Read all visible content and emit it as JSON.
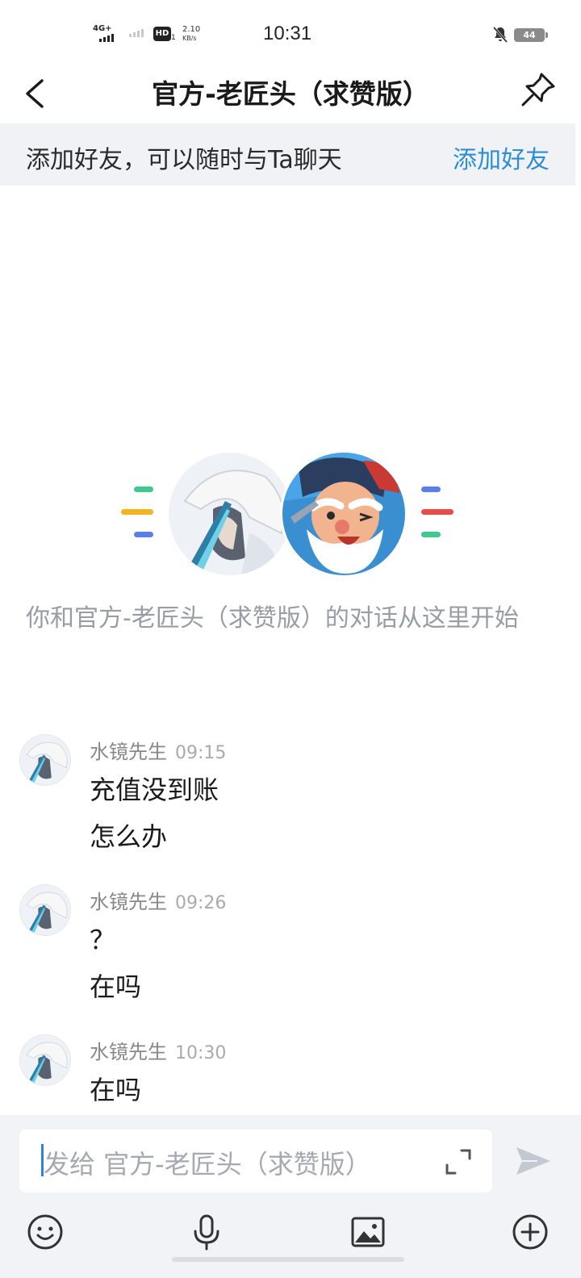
{
  "status_bar": {
    "network": "4G+",
    "hd": "HD",
    "hd_sub": "1",
    "speed_value": "2.10",
    "speed_unit": "KB/s",
    "time": "10:31",
    "battery": "44"
  },
  "header": {
    "title": "官方-老匠头（求赞版）",
    "back_icon": "chevron-left-icon",
    "pin_icon": "pin-icon"
  },
  "add_friend_banner": {
    "text": "添加好友，可以随时与Ta聊天",
    "link": "添加好友",
    "link_color": "#2d8ed8"
  },
  "intro": {
    "text": "你和官方-老匠头（求赞版）的对话从这里开始"
  },
  "messages": [
    {
      "sender": "水镜先生",
      "time": "09:15",
      "lines": [
        "充值没到账",
        "怎么办"
      ]
    },
    {
      "sender": "水镜先生",
      "time": "09:26",
      "lines": [
        "？",
        "在吗"
      ]
    },
    {
      "sender": "水镜先生",
      "time": "10:30",
      "lines": [
        "在吗"
      ]
    }
  ],
  "input": {
    "placeholder": "发给 官方-老匠头（求赞版）"
  },
  "toolbar": {
    "icons": [
      "emoji-icon",
      "microphone-icon",
      "image-icon",
      "plus-circle-icon"
    ]
  },
  "colors": {
    "accent": "#2d8ed8",
    "banner_bg": "#f0f2f6",
    "input_area_bg": "#f2f3f7"
  }
}
